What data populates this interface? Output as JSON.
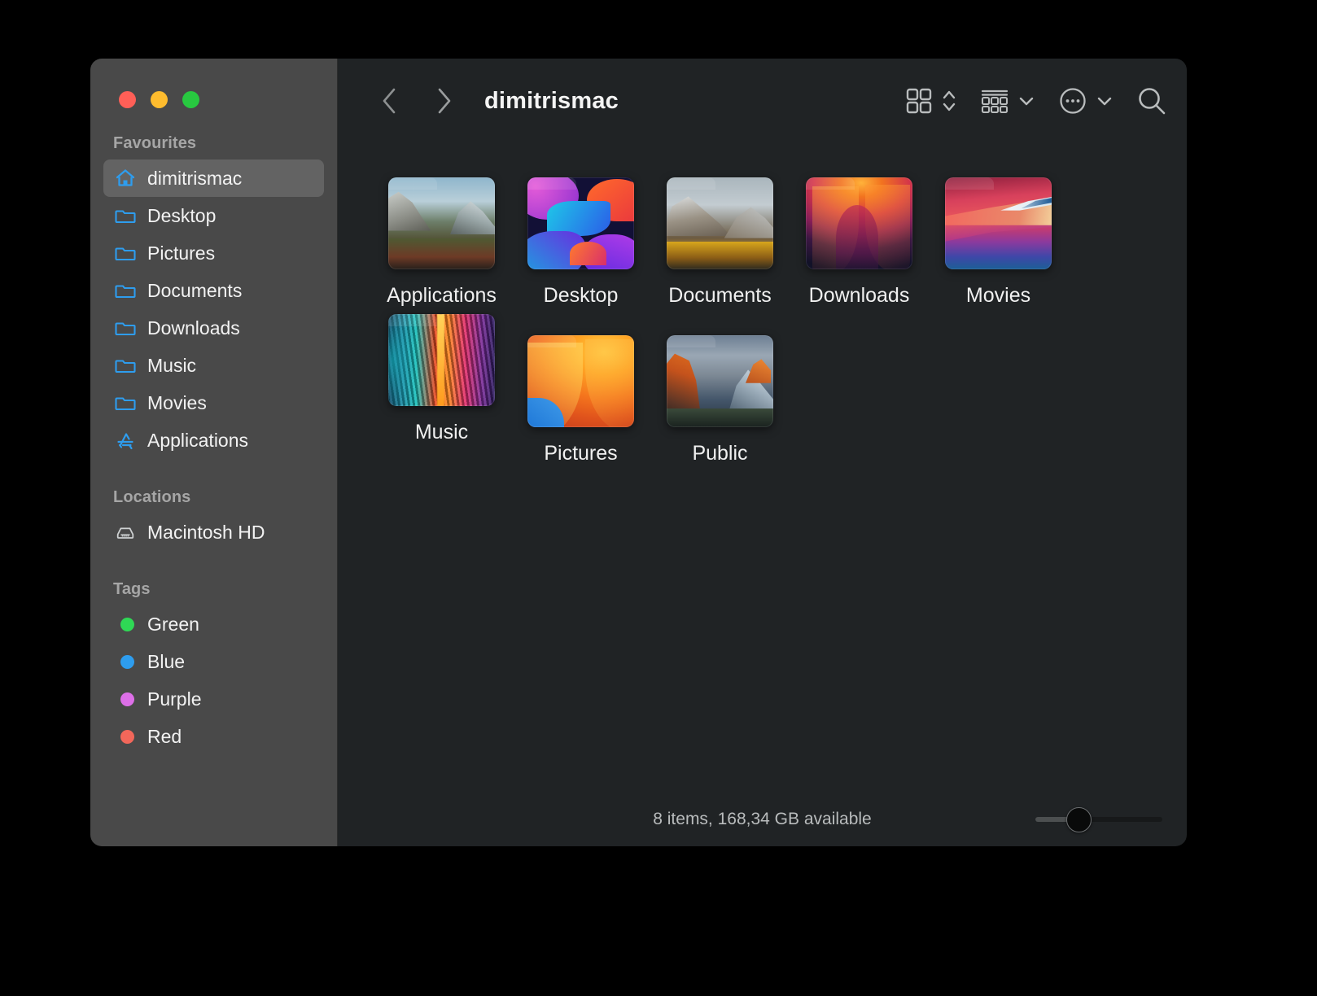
{
  "window": {
    "title": "dimitrismac",
    "traffic_lights": [
      {
        "name": "close",
        "color": "#ff5f57"
      },
      {
        "name": "minimize",
        "color": "#febc2e"
      },
      {
        "name": "zoom",
        "color": "#28c840"
      }
    ]
  },
  "toolbar": {
    "back_icon": "chevron-left-icon",
    "forward_icon": "chevron-right-icon",
    "title": "dimitrismac",
    "view_icon": "grid-view-icon",
    "view_sort_icon": "chevron-up-down-icon",
    "group_icon": "group-by-icon",
    "group_chevron_icon": "chevron-down-icon",
    "more_icon": "ellipsis-circle-icon",
    "more_chevron_icon": "chevron-down-icon",
    "search_icon": "search-icon"
  },
  "sidebar": {
    "sections": [
      {
        "label": "Favourites",
        "items": [
          {
            "label": "dimitrismac",
            "icon": "home-icon",
            "selected": true
          },
          {
            "label": "Desktop",
            "icon": "folder-icon",
            "selected": false
          },
          {
            "label": "Pictures",
            "icon": "folder-icon",
            "selected": false
          },
          {
            "label": "Documents",
            "icon": "folder-icon",
            "selected": false
          },
          {
            "label": "Downloads",
            "icon": "folder-icon",
            "selected": false
          },
          {
            "label": "Music",
            "icon": "folder-icon",
            "selected": false
          },
          {
            "label": "Movies",
            "icon": "folder-icon",
            "selected": false
          },
          {
            "label": "Applications",
            "icon": "app-store-icon",
            "selected": false
          }
        ]
      },
      {
        "label": "Locations",
        "items": [
          {
            "label": "Macintosh HD",
            "icon": "hard-drive-icon",
            "selected": false
          }
        ]
      },
      {
        "label": "Tags",
        "items": [
          {
            "label": "Green",
            "icon": "tag-dot-icon",
            "color": "#2fd855",
            "selected": false
          },
          {
            "label": "Blue",
            "icon": "tag-dot-icon",
            "color": "#2e9dee",
            "selected": false
          },
          {
            "label": "Purple",
            "icon": "tag-dot-icon",
            "color": "#dd6fe8",
            "selected": false
          },
          {
            "label": "Red",
            "icon": "tag-dot-icon",
            "color": "#f2675a",
            "selected": false
          }
        ]
      }
    ],
    "accent_color": "#2e9dee"
  },
  "files": [
    {
      "name": "Applications",
      "thumb": "yosemite-valley"
    },
    {
      "name": "Desktop",
      "thumb": "sonoma-shapes"
    },
    {
      "name": "Documents",
      "thumb": "high-sierra"
    },
    {
      "name": "Downloads",
      "thumb": "ventura-dark"
    },
    {
      "name": "Movies",
      "thumb": "big-sur"
    },
    {
      "name": "Music",
      "thumb": "music-strands"
    },
    {
      "name": "Pictures",
      "thumb": "ventura-light"
    },
    {
      "name": "Public",
      "thumb": "el-capitan"
    }
  ],
  "status": {
    "text": "8 items, 168,34 GB available",
    "zoom_value": 30
  }
}
